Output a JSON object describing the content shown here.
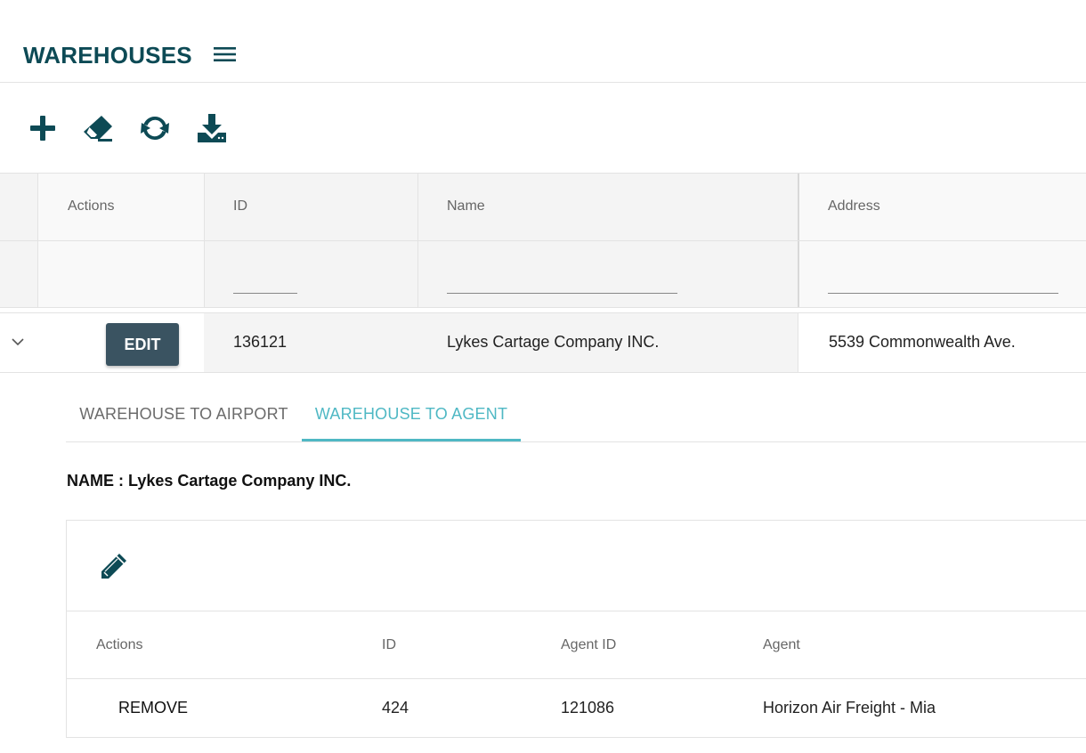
{
  "header": {
    "title": "WAREHOUSES",
    "menu_icon": "hamburger-menu-icon"
  },
  "toolbar": {
    "buttons": [
      {
        "icon": "plus-icon",
        "action": "add"
      },
      {
        "icon": "eraser-icon",
        "action": "clear"
      },
      {
        "icon": "refresh-icon",
        "action": "refresh"
      },
      {
        "icon": "download-icon",
        "action": "export"
      }
    ]
  },
  "grid": {
    "columns": {
      "actions": "Actions",
      "id": "ID",
      "name": "Name",
      "address": "Address"
    },
    "filters": {
      "id": "",
      "name": "",
      "address": ""
    },
    "rows": [
      {
        "edit_label": "EDIT",
        "id": "136121",
        "name": "Lykes Cartage Company INC.",
        "address": "5539 Commonwealth Ave."
      }
    ]
  },
  "detail": {
    "tabs": [
      {
        "label": "WAREHOUSE TO AIRPORT",
        "active": false
      },
      {
        "label": "WAREHOUSE TO AGENT",
        "active": true
      }
    ],
    "name_line": "NAME : Lykes Cartage Company INC.",
    "toolbar_icon": "pencil-icon",
    "columns": {
      "actions": "Actions",
      "id": "ID",
      "agent_id": "Agent ID",
      "agent": "Agent"
    },
    "rows": [
      {
        "action_label": "REMOVE",
        "id": "424",
        "agent_id": "121086",
        "agent": "Horizon Air Freight - Mia"
      }
    ]
  },
  "colors": {
    "brand_dark": "#0d4a55",
    "accent": "#4fb8c4",
    "edit_button": "#3a5361",
    "header_shade": "#f4f4f4"
  }
}
